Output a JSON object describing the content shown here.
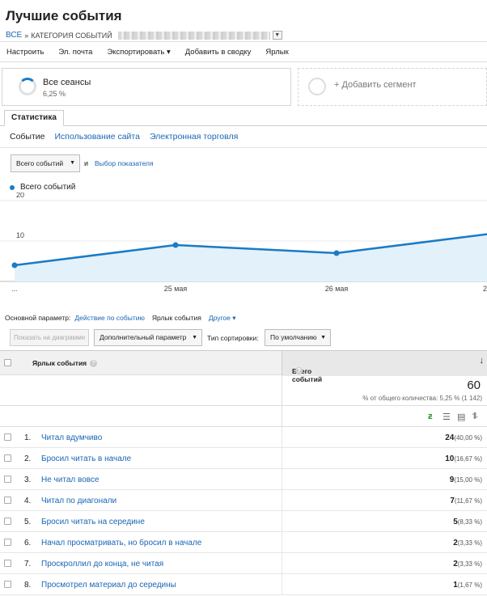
{
  "page": {
    "title": "Лучшие события",
    "breadcrumb_all": "ВСЕ",
    "breadcrumb_sep": "»",
    "breadcrumb_category": "КАТЕГОРИЯ СОБЫТИЙ"
  },
  "toolbar": {
    "customize": "Настроить",
    "email": "Эл. почта",
    "export": "Экспортировать ▾",
    "add_dashboard": "Добавить в сводку",
    "shortcut": "Ярлык"
  },
  "segments": {
    "active_name": "Все сеансы",
    "active_pct": "6,25 %",
    "add_label": "+ Добавить сегмент"
  },
  "tabs": {
    "stat": "Статистика",
    "event": "Событие",
    "site_usage": "Использование сайта",
    "ecommerce": "Электронная торговля"
  },
  "chart_controls": {
    "metric": "Всего событий",
    "and": "и",
    "pick_metric": "Выбор показателя"
  },
  "chart_data": {
    "type": "area",
    "legend": [
      "Всего событий"
    ],
    "x": [
      "...",
      "25 мая",
      "26 мая",
      "2"
    ],
    "series": [
      {
        "name": "Всего событий",
        "values": [
          4,
          9,
          7,
          12
        ]
      }
    ],
    "y_ticks": [
      "20",
      "10"
    ],
    "ylim": [
      0,
      20
    ],
    "colors": {
      "line": "#1a7bc6",
      "fill": "#e3f1fa"
    }
  },
  "dimension": {
    "label": "Основной параметр:",
    "action": "Действие по событию",
    "current": "Ярлык события",
    "other": "Другое ▾"
  },
  "table_controls": {
    "plot_rows": "Показать на диаграмме",
    "secondary": "Дополнительный параметр",
    "sort_label": "Тип сортировки:",
    "sort_value": "По умолчанию"
  },
  "table": {
    "col_label": "Ярлык события",
    "col_total": "Всего событий",
    "sort_arrow": "↓",
    "total_value": "60",
    "total_sub": "% от общего количества: 5,25 % (1 142)",
    "rows": [
      {
        "n": "1.",
        "label": "Читал вдумчиво",
        "value": "24",
        "pct": "(40,00 %)"
      },
      {
        "n": "2.",
        "label": "Бросил читать в начале",
        "value": "10",
        "pct": "(16,67 %)"
      },
      {
        "n": "3.",
        "label": "Не читал вовсе",
        "value": "9",
        "pct": "(15,00 %)"
      },
      {
        "n": "4.",
        "label": "Читал по диагонали",
        "value": "7",
        "pct": "(11,67 %)"
      },
      {
        "n": "5.",
        "label": "Бросил читать на середине",
        "value": "5",
        "pct": "(8,33 %)"
      },
      {
        "n": "6.",
        "label": "Начал просматривать, но бросил в начале",
        "value": "2",
        "pct": "(3,33 %)"
      },
      {
        "n": "7.",
        "label": "Проскроллил до конца, не читая",
        "value": "2",
        "pct": "(3,33 %)"
      },
      {
        "n": "8.",
        "label": "Просмотрел материал до середины",
        "value": "1",
        "pct": "(1,67 %)"
      }
    ]
  }
}
